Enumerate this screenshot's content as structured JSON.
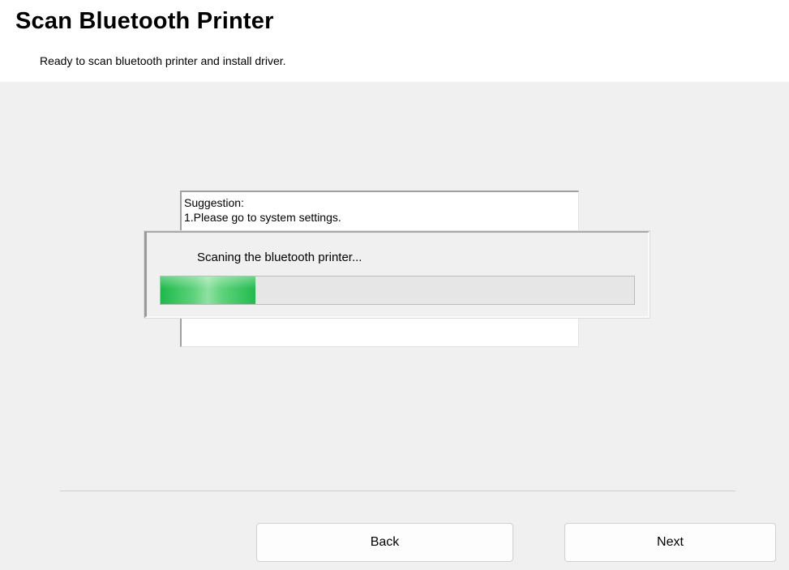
{
  "header": {
    "title": "Scan Bluetooth Printer",
    "subtitle": "Ready to scan bluetooth printer and install driver."
  },
  "suggestion": {
    "text": "Suggestion:\n1.Please go to system settings."
  },
  "progress": {
    "label": "Scaning the bluetooth printer...",
    "fraction": 0.2
  },
  "buttons": {
    "back_label": "Back",
    "next_label": "Next"
  }
}
